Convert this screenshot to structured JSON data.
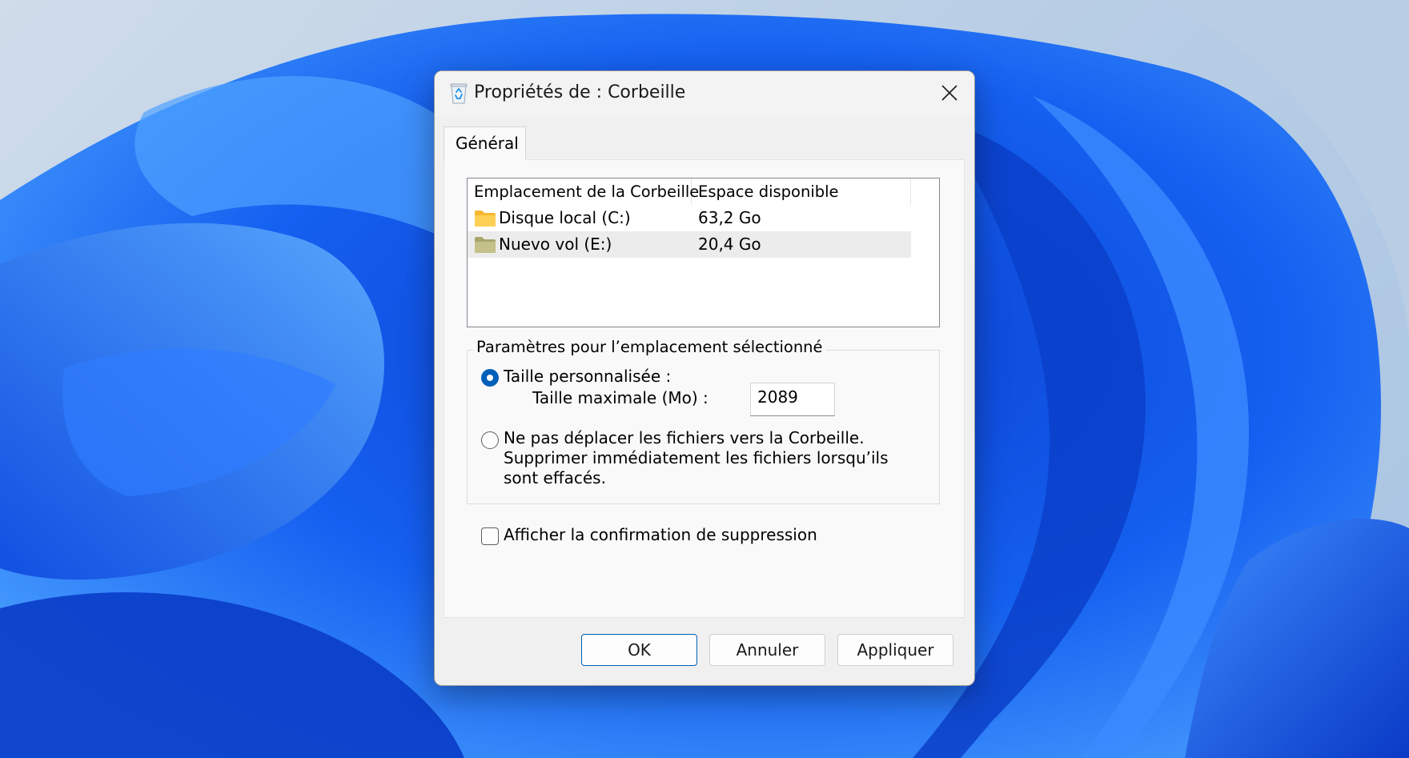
{
  "window": {
    "title": "Propriétés de : Corbeille"
  },
  "tabs": [
    {
      "label": "Général",
      "selected": true
    }
  ],
  "location_list": {
    "columns": [
      "Emplacement de la Corbeille",
      "Espace disponible"
    ],
    "rows": [
      {
        "name": "Disque local (C:)",
        "space": "63,2 Go",
        "icon": "folder-icon",
        "selected": false
      },
      {
        "name": "Nuevo vol (E:)",
        "space": "20,4 Go",
        "icon": "folder-icon",
        "selected": true
      }
    ]
  },
  "settings_group": {
    "legend": "Paramètres pour l’emplacement sélectionné",
    "custom_size_label": "Taille personnalisée :",
    "custom_size_selected": true,
    "max_size_label": "Taille maximale (Mo) :",
    "max_size_value": "2089",
    "no_recycle_label": "Ne pas déplacer les fichiers vers la Corbeille. Supprimer immédiatement les fichiers lorsqu’ils sont effacés.",
    "no_recycle_selected": false
  },
  "confirm_delete": {
    "label": "Afficher la confirmation de suppression",
    "checked": false
  },
  "buttons": {
    "ok": "OK",
    "cancel": "Annuler",
    "apply": "Appliquer"
  },
  "colors": {
    "accent": "#005fb8",
    "selected_row": "#ececec"
  }
}
